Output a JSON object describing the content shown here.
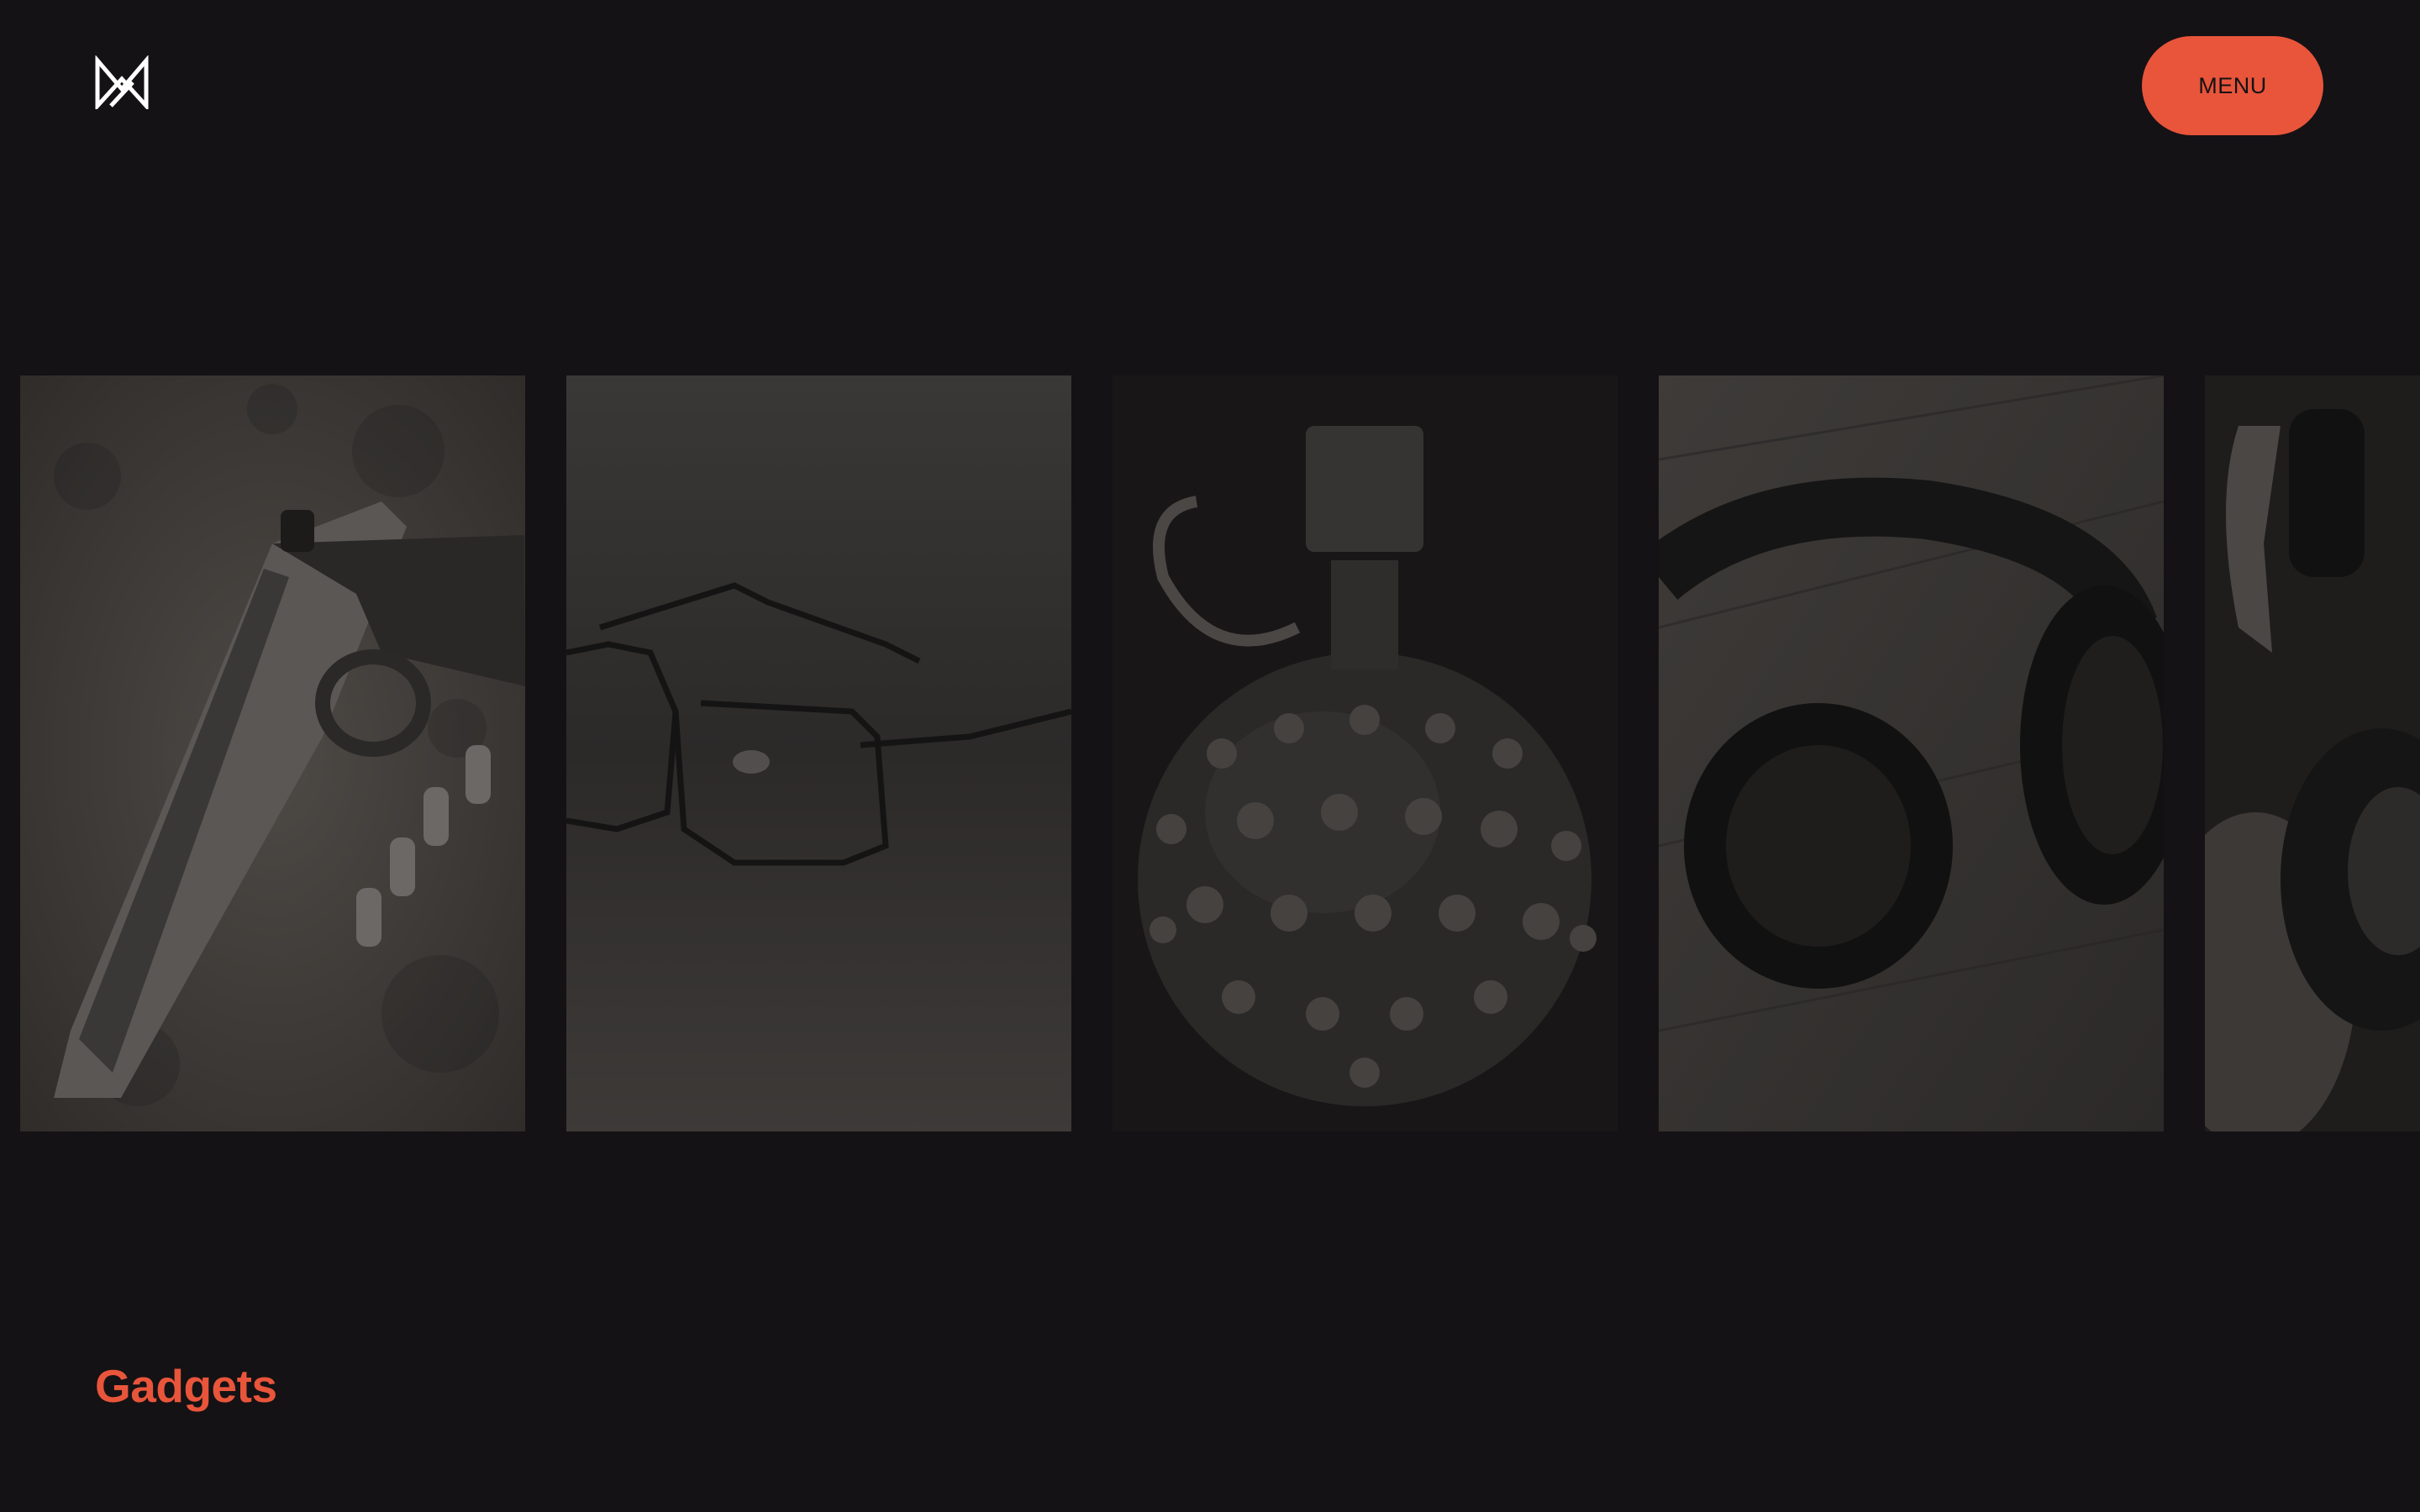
{
  "header": {
    "logo_icon": "mw-monogram-logo-icon",
    "menu_label": "MENU"
  },
  "gallery": {
    "items": [
      {
        "subject": "pistol",
        "icon": "pistol-image"
      },
      {
        "subject": "glasses",
        "icon": "glasses-image"
      },
      {
        "subject": "spiked-grenade",
        "icon": "grenade-image"
      },
      {
        "subject": "headphones",
        "icon": "headphones-image"
      },
      {
        "subject": "gadget-partial",
        "icon": "gadget-image"
      }
    ]
  },
  "section": {
    "title": "Gadgets"
  },
  "colors": {
    "background": "#141214",
    "accent": "#e8553b",
    "logo": "#ffffff"
  }
}
